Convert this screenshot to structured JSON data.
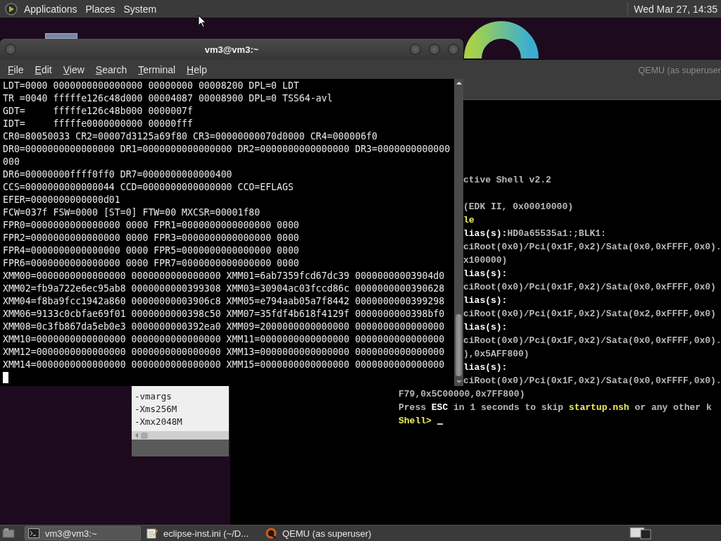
{
  "top_panel": {
    "menus": [
      "Applications",
      "Places",
      "System"
    ],
    "clock": "Wed Mar 27, 14:35"
  },
  "terminal_window": {
    "title": "vm3@vm3:~",
    "menu": [
      "File",
      "Edit",
      "View",
      "Search",
      "Terminal",
      "Help"
    ],
    "lines": [
      "LDT=0000 0000000000000000 00000000 00008200 DPL=0 LDT",
      "TR =0040 fffffe126c48d000 00004087 00008900 DPL=0 TSS64-avl",
      "GDT=     fffffe126c48b000 0000007f",
      "IDT=     fffffe0000000000 00000fff",
      "CR0=80050033 CR2=00007d3125a69f80 CR3=00000000070d0000 CR4=000006f0",
      "DR0=0000000000000000 DR1=0000000000000000 DR2=0000000000000000 DR3=0000000000000",
      "000",
      "DR6=00000000ffff0ff0 DR7=0000000000000400",
      "CCS=0000000000000044 CCD=0000000000000000 CCO=EFLAGS",
      "EFER=0000000000000d01",
      "FCW=037f FSW=0000 [ST=0] FTW=00 MXCSR=00001f80",
      "FPR0=0000000000000000 0000 FPR1=0000000000000000 0000",
      "FPR2=0000000000000000 0000 FPR3=0000000000000000 0000",
      "FPR4=0000000000000000 0000 FPR5=0000000000000000 0000",
      "FPR6=0000000000000000 0000 FPR7=0000000000000000 0000",
      "XMM00=0000000000000000 0000000000000000 XMM01=6ab7359fcd67dc39 00000000003904d0",
      "XMM02=fb9a722e6ec95ab8 0000000000399308 XMM03=30904ac03fccd86c 0000000000390628",
      "XMM04=f8ba9fcc1942a860 00000000003906c8 XMM05=e794aab05a7f8442 0000000000399298",
      "XMM06=9133c0cbfae69f01 0000000000398c50 XMM07=35fdf4b618f4129f 0000000000398bf0",
      "XMM08=0c3fb867da5eb0e3 0000000000392ea0 XMM09=2000000000000000 0000000000000000",
      "XMM10=0000000000000000 0000000000000000 XMM11=0000000000000000 0000000000000000",
      "XMM12=0000000000000000 0000000000000000 XMM13=0000000000000000 0000000000000000",
      "XMM14=0000000000000000 0000000000000000 XMM15=0000000000000000 0000000000000000"
    ]
  },
  "editor_window": {
    "lines": [
      "-vmargs",
      "-Xms256M",
      "-Xmx2048M"
    ]
  },
  "qemu_window": {
    "title": "QEMU (as superuser",
    "lines": [
      {
        "segments": [
          {
            "text": "ctive Shell v2.2",
            "color": "#b8b8b8"
          }
        ]
      },
      {
        "segments": [
          {
            "text": "(EDK II, 0x00010000)",
            "color": "#b8b8b8"
          }
        ]
      },
      {
        "segments": [
          {
            "text": "le",
            "color": "#ecec5c"
          }
        ]
      },
      {
        "segments": [
          {
            "text": "lias(s):",
            "color": "#ffffff"
          },
          {
            "text": "HD0a65535a1:;BLK1:",
            "color": "#b8b8b8"
          }
        ]
      },
      {
        "segments": [
          {
            "text": "ciRoot(0x0)/Pci(0x1F,0x2)/Sata(0x0,0xFFFF,0x0).",
            "color": "#b8b8b8"
          }
        ]
      },
      {
        "segments": [
          {
            "text": "x100000)",
            "color": "#b8b8b8"
          }
        ]
      },
      {
        "segments": [
          {
            "text": "lias(s):",
            "color": "#ffffff"
          }
        ]
      },
      {
        "segments": [
          {
            "text": "ciRoot(0x0)/Pci(0x1F,0x2)/Sata(0x0,0xFFFF,0x0)",
            "color": "#b8b8b8"
          }
        ]
      },
      {
        "segments": [
          {
            "text": "lias(s):",
            "color": "#ffffff"
          }
        ]
      },
      {
        "segments": [
          {
            "text": "ciRoot(0x0)/Pci(0x1F,0x2)/Sata(0x2,0xFFFF,0x0)",
            "color": "#b8b8b8"
          }
        ]
      },
      {
        "segments": [
          {
            "text": "lias(s):",
            "color": "#ffffff"
          }
        ]
      },
      {
        "segments": [
          {
            "text": "ciRoot(0x0)/Pci(0x1F,0x2)/Sata(0x0,0xFFFF,0x0).",
            "color": "#b8b8b8"
          }
        ]
      },
      {
        "segments": [
          {
            "text": "),0x5AFF800)",
            "color": "#b8b8b8"
          }
        ]
      },
      {
        "segments": [
          {
            "text": "lias(s):",
            "color": "#ffffff"
          }
        ]
      },
      {
        "segments": [
          {
            "text": "ciRoot(0x0)/Pci(0x1F,0x2)/Sata(0x0,0xFFFF,0x0).",
            "color": "#b8b8b8"
          }
        ]
      },
      {
        "segments": [
          {
            "text": "F79,0x5C00000,0x7FF800)",
            "color": "#b8b8b8"
          }
        ]
      },
      {
        "segments": [
          {
            "text": "Press ",
            "color": "#b8b8b8"
          },
          {
            "text": "ESC",
            "color": "#ffffff"
          },
          {
            "text": " in 1 seconds to skip ",
            "color": "#b8b8b8"
          },
          {
            "text": "startup.nsh",
            "color": "#ecec5c"
          },
          {
            "text": " or any other k",
            "color": "#b8b8b8"
          }
        ]
      },
      {
        "segments": [
          {
            "text": "Shell>",
            "color": "#ecec5c"
          }
        ]
      }
    ]
  },
  "taskbar": {
    "items": [
      {
        "label": "vm3@vm3:~",
        "kind": "terminal",
        "selected": true
      },
      {
        "label": "eclipse-inst.ini (~/D...",
        "kind": "editor",
        "selected": false
      },
      {
        "label": "QEMU (as superuser)",
        "kind": "qemu",
        "selected": false
      }
    ]
  }
}
